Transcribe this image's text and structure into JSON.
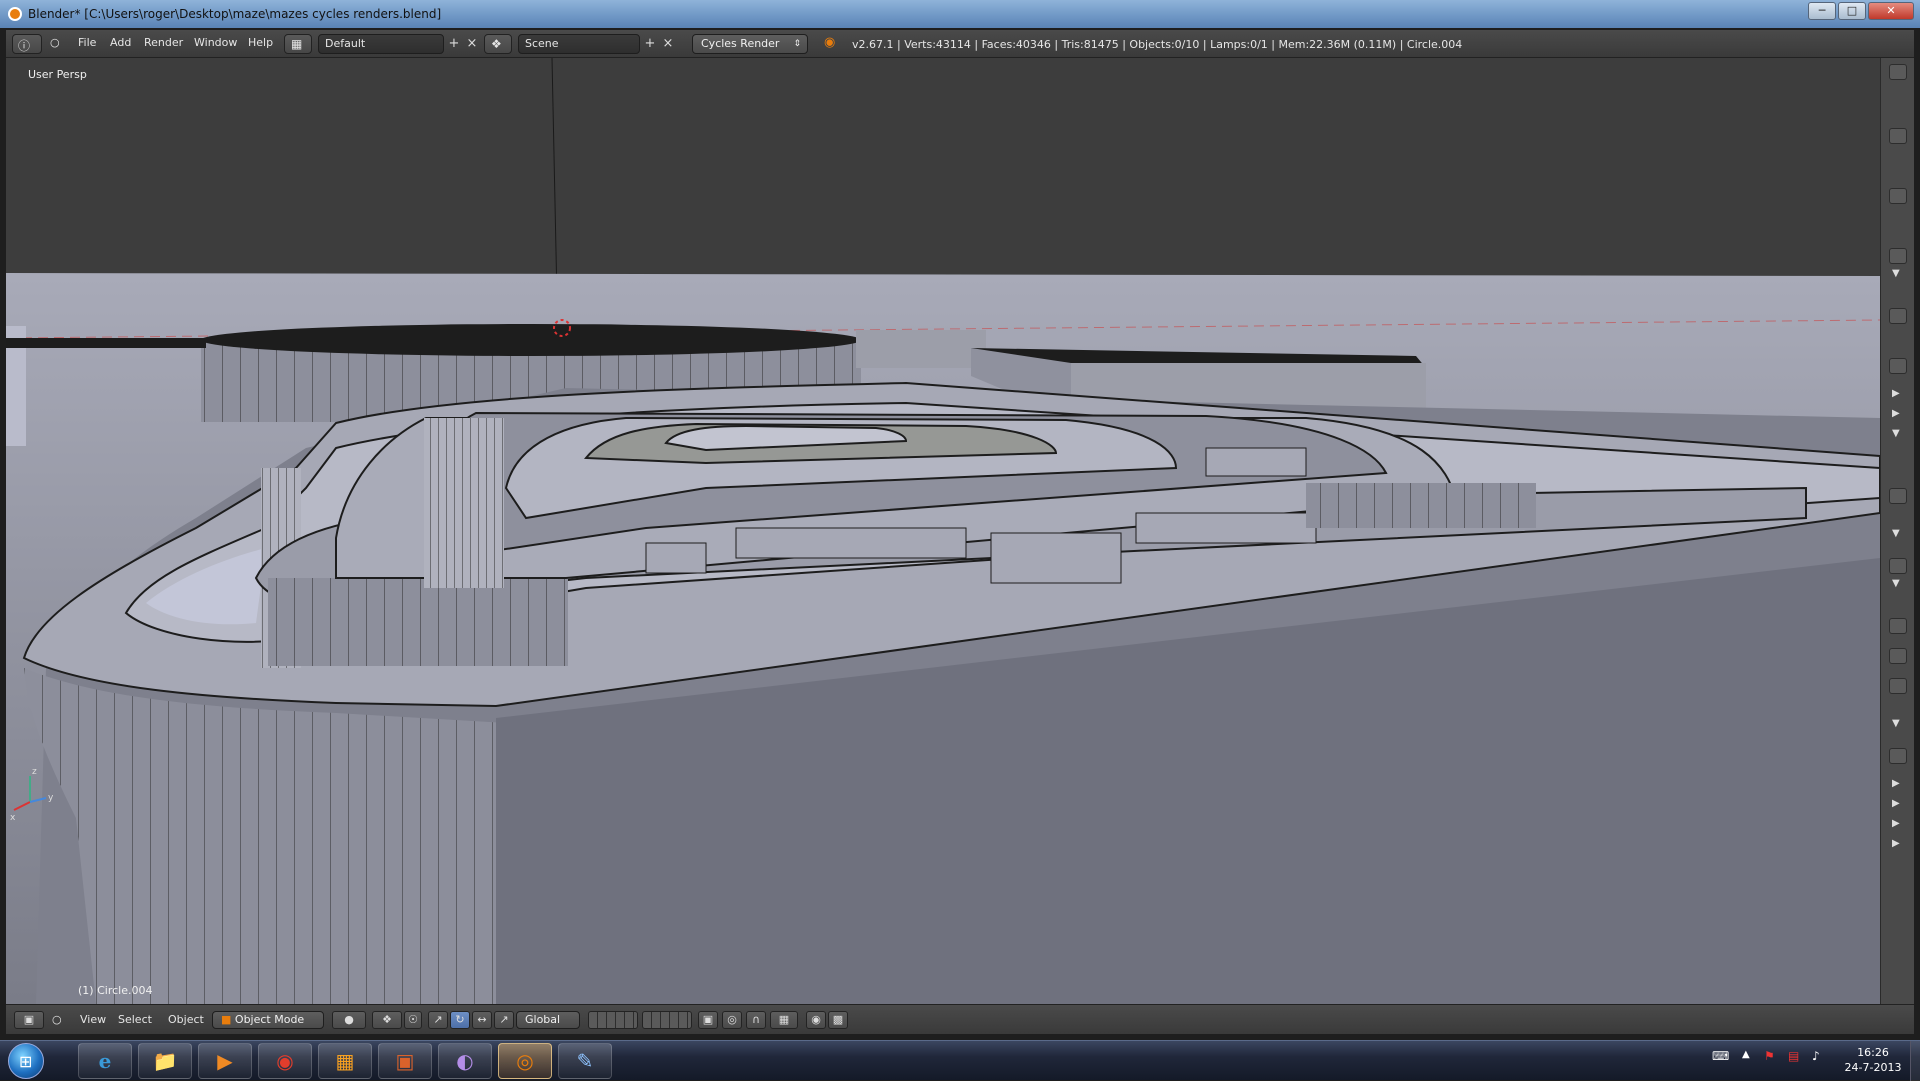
{
  "window": {
    "title": "Blender* [C:\\Users\\roger\\Desktop\\maze\\mazes cycles renders.blend]",
    "minimize": "─",
    "maximize": "□",
    "close": "✕"
  },
  "info_header": {
    "editor_icon": "info-icon",
    "menus": [
      "File",
      "Add",
      "Render",
      "Window",
      "Help"
    ],
    "screen_layout": "Default",
    "scene": "Scene",
    "render_engine": "Cycles Render",
    "stats": "v2.67.1 | Verts:43114 | Faces:40346 | Tris:81475 | Objects:0/10 | Lamps:0/1 | Mem:22.36M (0.11M) | Circle.004"
  },
  "viewport": {
    "view_label": "User Persp",
    "active_object": "(1) Circle.004",
    "axis": {
      "x": "x",
      "y": "y",
      "z": "z"
    }
  },
  "view_header": {
    "menus": [
      "View",
      "Select",
      "Object"
    ],
    "mode": "Object Mode",
    "transform_orientation": "Global"
  },
  "taskbar": {
    "start": "⊞",
    "apps": [
      {
        "name": "internet-explorer",
        "glyph": "e",
        "active": false
      },
      {
        "name": "file-explorer",
        "glyph": "📁",
        "active": false
      },
      {
        "name": "media-player",
        "glyph": "▶",
        "active": false
      },
      {
        "name": "chrome",
        "glyph": "◉",
        "active": false
      },
      {
        "name": "app-orange",
        "glyph": "▦",
        "active": false
      },
      {
        "name": "app-toolbox",
        "glyph": "▣",
        "active": false
      },
      {
        "name": "app-purple",
        "glyph": "◐",
        "active": false
      },
      {
        "name": "blender",
        "glyph": "◎",
        "active": true
      },
      {
        "name": "paint",
        "glyph": "✎",
        "active": false
      }
    ],
    "time": "16:26",
    "date": "24-7-2013"
  },
  "colors": {
    "viewport_bg": "#3d3d3d",
    "ground": "#8a8c98",
    "maze_light": "#b5b7c4",
    "maze_dark": "#6f717e",
    "wire": "#1a1a1a",
    "accent": "#e87d0d"
  }
}
